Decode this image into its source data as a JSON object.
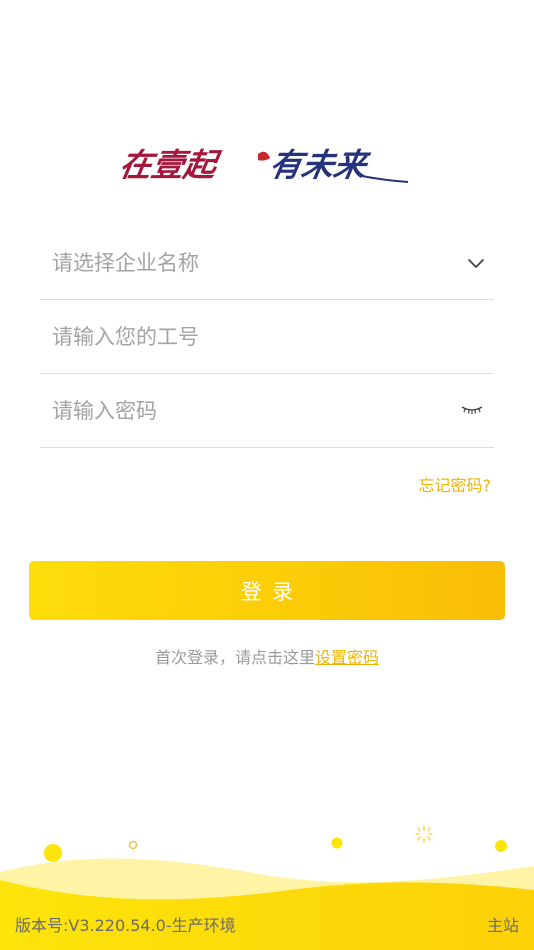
{
  "logo": {
    "slogan_part1": "在壹起",
    "slogan_part2": "有未来"
  },
  "form": {
    "company_placeholder": "请选择企业名称",
    "employee_no_placeholder": "请输入您的工号",
    "password_placeholder": "请输入密码",
    "forgot_password": "忘记密码?",
    "login_label": "登录",
    "first_login_hint": "首次登录，请点击这里",
    "set_password_link": "设置密码"
  },
  "footer": {
    "version": "版本号:V3.220.54.0-生产环境",
    "main_site": "主站"
  },
  "colors": {
    "accent": "#f8c305",
    "link": "#f0b400",
    "logo_red": "#a3173b",
    "logo_blue": "#26337a"
  },
  "icons": {
    "company_dropdown": "chevron-down-icon",
    "password_visibility": "eye-closed-icon",
    "loading": "spinner-icon"
  }
}
